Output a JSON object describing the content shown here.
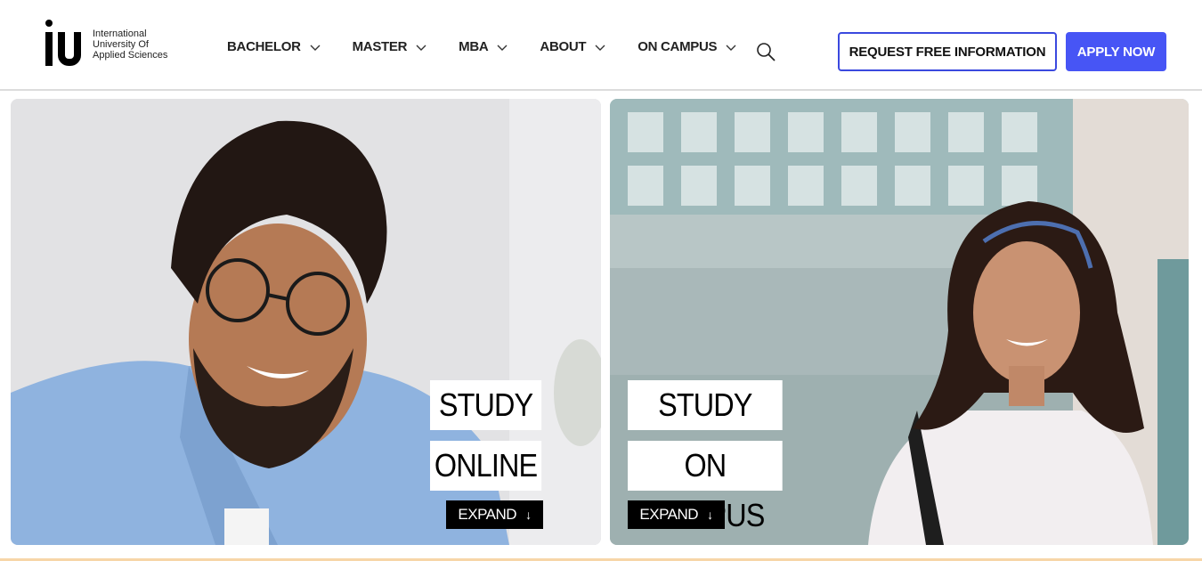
{
  "logo": {
    "mark": "iu",
    "text": "International University Of Applied Sciences"
  },
  "nav": {
    "items": [
      {
        "label": "BACHELOR"
      },
      {
        "label": "MASTER"
      },
      {
        "label": "MBA"
      },
      {
        "label": "ABOUT"
      },
      {
        "label": "ON CAMPUS"
      }
    ],
    "search_icon": "search-icon",
    "chevron_icon": "chevron-down-icon"
  },
  "header": {
    "request_info_label": "REQUEST FREE INFORMATION",
    "apply_label": "APPLY NOW"
  },
  "cards": {
    "online": {
      "line1": "STUDY",
      "line2": "ONLINE",
      "expand_label": "EXPAND",
      "arrow": "↓"
    },
    "campus": {
      "line1": "STUDY",
      "line2": "ON CAMPUS",
      "expand_label": "EXPAND",
      "arrow": "↓"
    }
  },
  "colors": {
    "accent": "#4755f5",
    "outline": "#3b49df"
  }
}
